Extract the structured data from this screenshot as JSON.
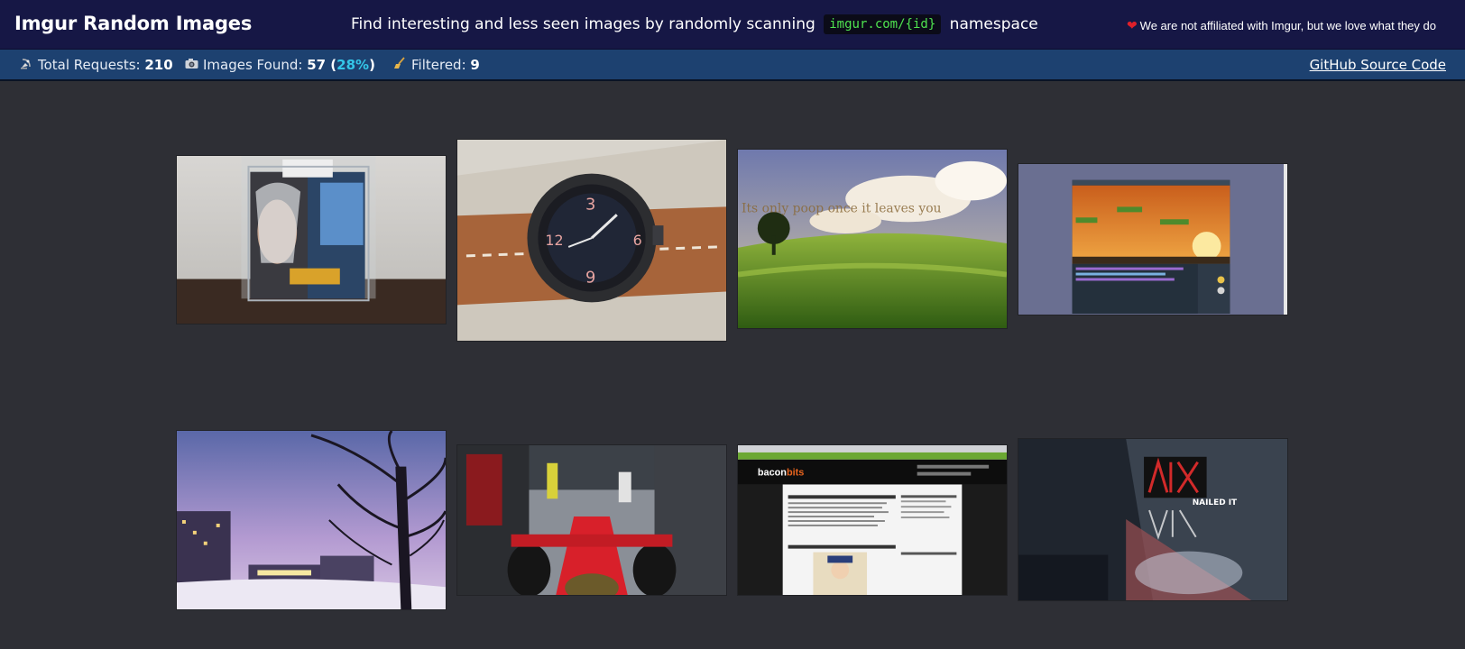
{
  "header": {
    "title": "Imgur Random Images",
    "tagline_before": "Find interesting and less seen images by randomly scanning",
    "tagline_code": "imgur.com/{id}",
    "tagline_after": "namespace",
    "disclaimer": "We are not affiliated with Imgur, but we love what they do"
  },
  "stats": {
    "requests_label": "Total Requests: ",
    "requests_value": "210",
    "found_label": "Images Found: ",
    "found_value": "57",
    "found_open": " (",
    "found_pct": "28%",
    "found_close": ")",
    "filtered_label": "Filtered: ",
    "filtered_value": "9",
    "github_label": "GitHub Source Code"
  },
  "images": {
    "img3_caption": "Its only poop once it leaves you",
    "img7_site": "bacon",
    "img7_site_accent": "bits",
    "img8_caption": "NAILED IT"
  },
  "colors": {
    "header_bg": "#161745",
    "stats_bg": "#1d4170",
    "page_bg": "#2e2f35",
    "code_text": "#4fe34f",
    "percent_accent": "#34c6e8",
    "heart": "#e0202a"
  }
}
